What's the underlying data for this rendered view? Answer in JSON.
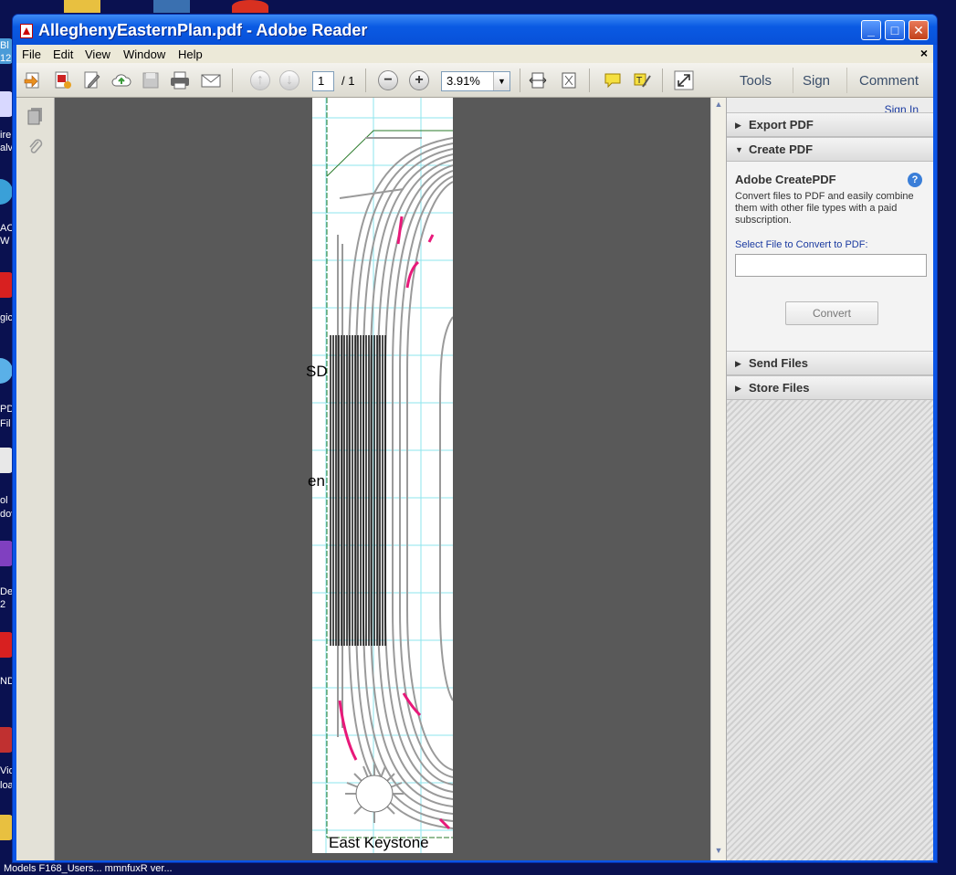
{
  "desktop": {
    "labels": [
      "Bl",
      "12",
      "ire",
      "alv",
      "AC",
      "W",
      "gic",
      "PD",
      "Fil",
      "ol",
      "dov",
      "De",
      "2",
      "ND",
      "Vid",
      "loa"
    ],
    "taskbar_text": "Models  F168_Users...  mmnfuxR ver..."
  },
  "window": {
    "title": "AlleghenyEasternPlan.pdf - Adobe Reader",
    "minimize": "_",
    "maximize": "□",
    "close": "✕"
  },
  "menu": {
    "items": [
      "File",
      "Edit",
      "View",
      "Window",
      "Help"
    ],
    "doc_close": "×"
  },
  "toolbar": {
    "page_current": "1",
    "page_total": "/ 1",
    "zoom": "3.91%",
    "zoom_dropdown": "▼",
    "zoom_out": "−",
    "zoom_in": "+",
    "tools": "Tools",
    "sign": "Sign",
    "comment": "Comment"
  },
  "document": {
    "label_left_1": "SD",
    "label_left_2": "en",
    "bottom_label": "East Keystone"
  },
  "rightpane": {
    "sign_in": "Sign In",
    "export_pdf": "Export PDF",
    "create_pdf": "Create PDF",
    "panel_title": "Adobe CreatePDF",
    "help": "?",
    "description": "Convert files to PDF and easily combine them with other file types with a paid subscription.",
    "select_label": "Select File to Convert to PDF:",
    "convert_button": "Convert",
    "send_files": "Send Files",
    "store_files": "Store Files"
  },
  "colors": {
    "title_bar": "#0a5ae3",
    "track": "#9a9a9a",
    "highlight_track": "#e8197a",
    "grid": "#8ee6ee"
  }
}
